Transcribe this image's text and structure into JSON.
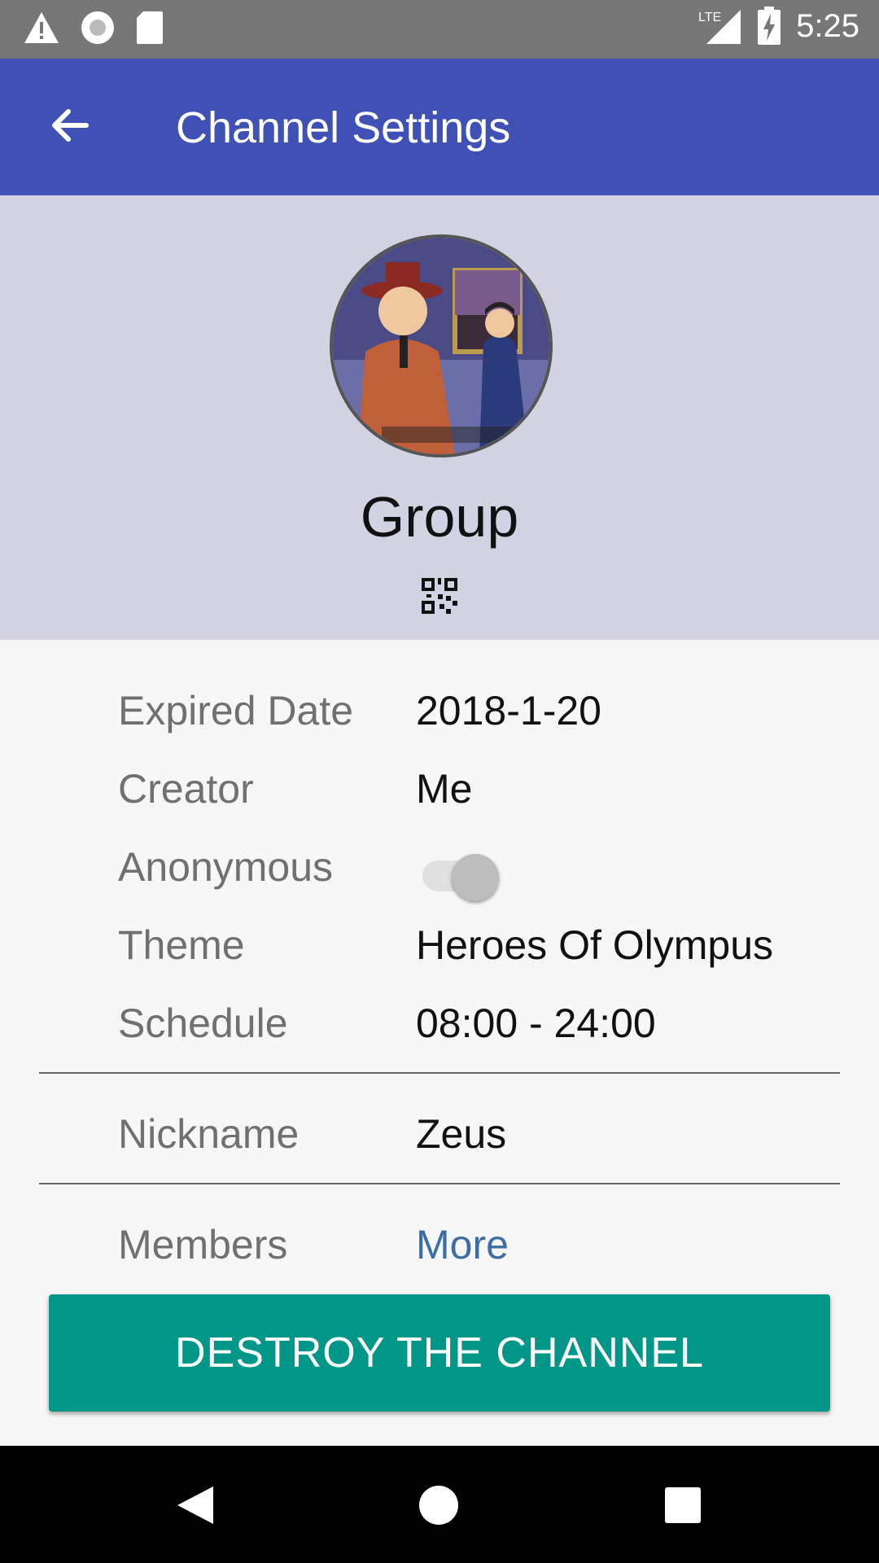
{
  "status_bar": {
    "time": "5:25",
    "network": "LTE",
    "icons": [
      "warning-icon",
      "circle-icon",
      "sd-card-icon",
      "lte-signal-icon",
      "battery-charging-icon"
    ]
  },
  "app_bar": {
    "title": "Channel Settings",
    "back_icon": "arrow-back-icon",
    "color": "#3f51b5"
  },
  "channel": {
    "name": "Group",
    "qr_icon": "qr-code-icon"
  },
  "details": [
    {
      "label": "Expired Date",
      "value": "2018-1-20"
    },
    {
      "label": "Creator",
      "value": "Me"
    },
    {
      "label": "Anonymous",
      "toggle_on": false
    },
    {
      "label": "Theme",
      "value": "Heroes Of Olympus"
    },
    {
      "label": "Schedule",
      "value": "08:00 - 24:00"
    }
  ],
  "nickname": {
    "label": "Nickname",
    "value": "Zeus"
  },
  "members": {
    "label": "Members",
    "link": "More"
  },
  "destroy_button": {
    "label": "DESTROY THE CHANNEL",
    "color": "#009688"
  },
  "nav_bar": {
    "icons": [
      "back-triangle-icon",
      "home-circle-icon",
      "recents-square-icon"
    ]
  }
}
